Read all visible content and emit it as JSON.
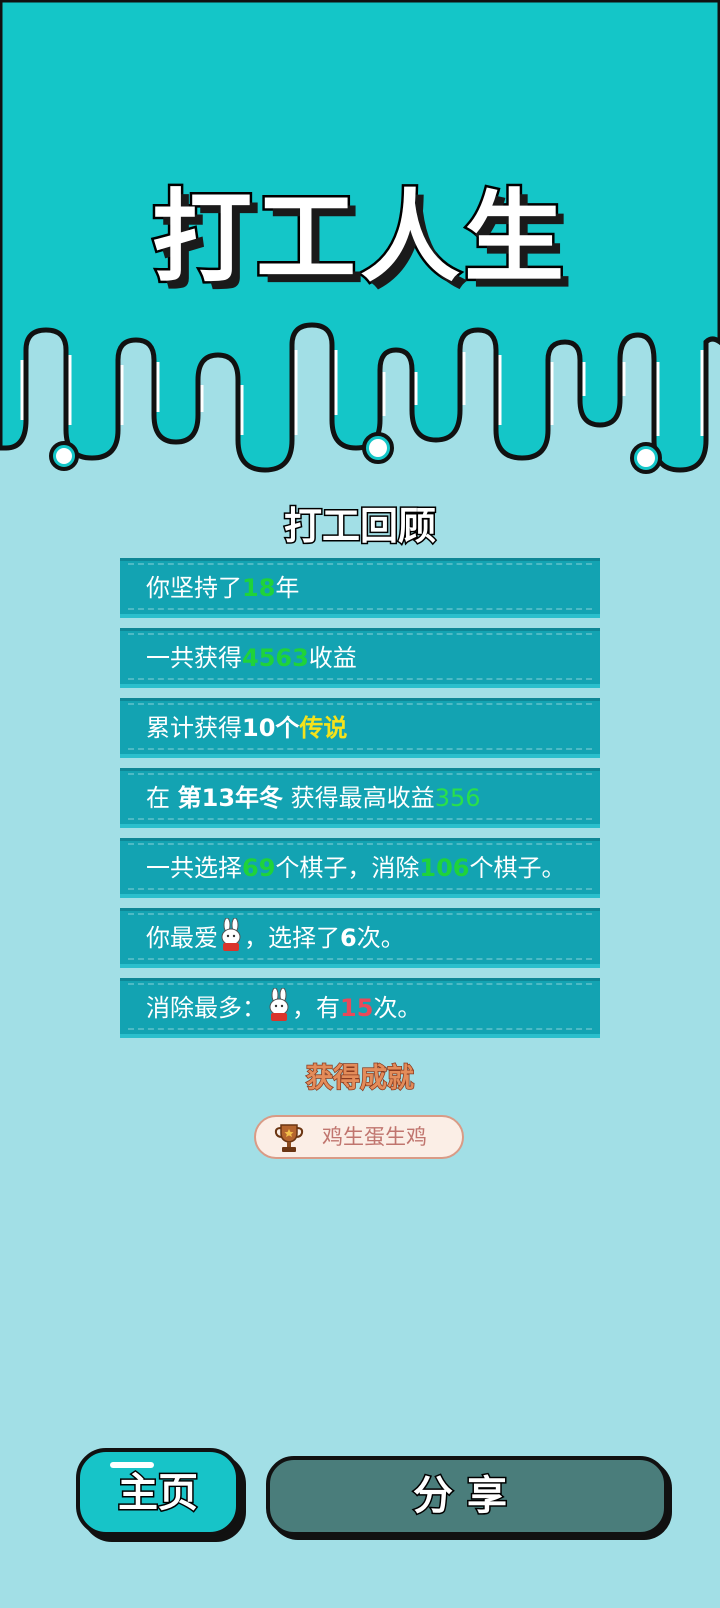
{
  "title": "打工人生",
  "review": {
    "heading": "打工回顾",
    "rows": [
      {
        "pre": "你坚持了",
        "years": "18",
        "post": "年"
      },
      {
        "pre": "一共获得",
        "income": "4563",
        "post": "收益"
      },
      {
        "pre": "累计获得",
        "count": "10个",
        "legend": "传说"
      },
      {
        "pre": "在 ",
        "season": "第13年冬",
        "mid": " 获得最高收益",
        "max": "356"
      },
      {
        "pre": "一共选择",
        "chosen": "69",
        "mid": "个棋子，消除",
        "removed": "106",
        "post": "个棋子。"
      },
      {
        "pre": "你最爱",
        "mid": "，选择了",
        "times": "6",
        "post": "次。",
        "icon": "bunny-icon"
      },
      {
        "pre": "消除最多：",
        "mid": "，有",
        "times": "15",
        "post": "次。",
        "icon": "bunny-icon"
      }
    ]
  },
  "achievement": {
    "heading": "获得成就",
    "badge_label": "鸡生蛋生鸡",
    "icon": "trophy-icon"
  },
  "buttons": {
    "home": "主页",
    "share": "分享"
  },
  "colors": {
    "top_band": "#14c6c8",
    "background": "#a2dfe6",
    "row": "#13a3b2",
    "highlight_green": "#1fd33a",
    "highlight_yellow": "#f5e21a",
    "highlight_red": "#e84a5a"
  }
}
